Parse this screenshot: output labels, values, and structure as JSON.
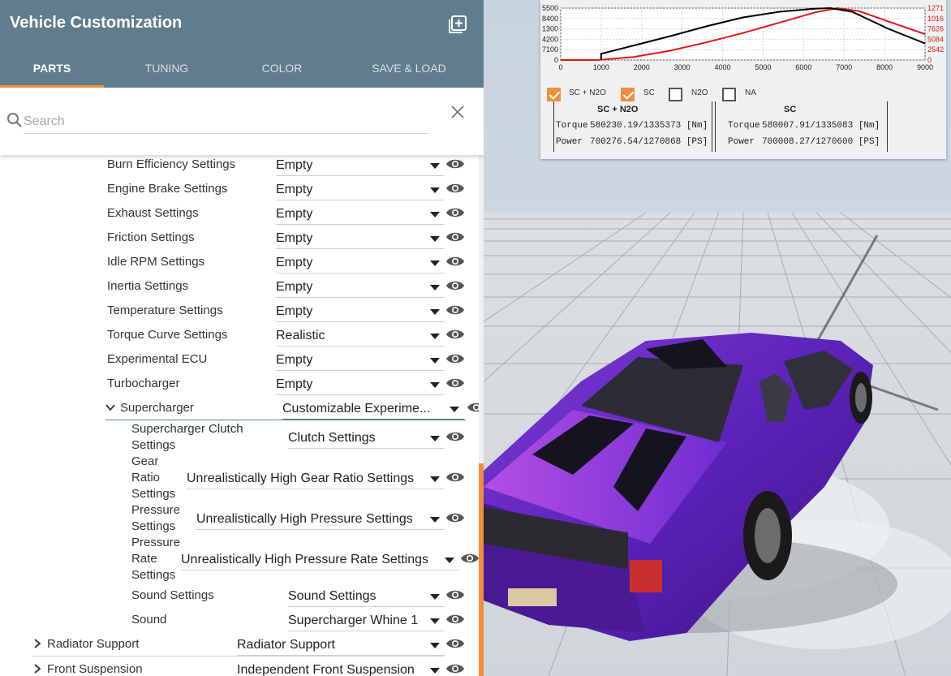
{
  "header": {
    "title": "Vehicle Customization",
    "tabs": [
      {
        "label": "PARTS",
        "active": true
      },
      {
        "label": "TUNING",
        "active": false
      },
      {
        "label": "COLOR",
        "active": false
      },
      {
        "label": "SAVE & LOAD",
        "active": false
      }
    ]
  },
  "search": {
    "placeholder": "Search",
    "value": ""
  },
  "parts": [
    {
      "label": "Burn Efficiency Settings",
      "value": "Empty"
    },
    {
      "label": "Engine Brake Settings",
      "value": "Empty"
    },
    {
      "label": "Exhaust Settings",
      "value": "Empty"
    },
    {
      "label": "Friction Settings",
      "value": "Empty"
    },
    {
      "label": "Idle RPM Settings",
      "value": "Empty"
    },
    {
      "label": "Inertia Settings",
      "value": "Empty"
    },
    {
      "label": "Temperature Settings",
      "value": "Empty"
    },
    {
      "label": "Torque Curve Settings",
      "value": "Realistic"
    },
    {
      "label": "Experimental ECU",
      "value": "Empty"
    },
    {
      "label": "Turbocharger",
      "value": "Empty"
    }
  ],
  "supercharger": {
    "label": "Supercharger",
    "value": "Customizable Experime...",
    "children": [
      {
        "label_lines": [
          "Supercharger Clutch",
          "Settings"
        ],
        "value": "Clutch Settings"
      },
      {
        "label_lines": [
          "Gear",
          "Ratio",
          "Settings"
        ],
        "value": "Unrealistically High Gear Ratio Settings"
      },
      {
        "label_lines": [
          "Pressure",
          "Settings"
        ],
        "value": "Unrealistically High Pressure Settings"
      },
      {
        "label_lines": [
          "Pressure",
          "Rate",
          "Settings"
        ],
        "value": "Unrealistically High Pressure Rate Settings"
      },
      {
        "label_lines": [
          "Sound Settings"
        ],
        "value": "Sound Settings"
      },
      {
        "label_lines": [
          "Sound"
        ],
        "value": "Supercharger Whine 1"
      }
    ]
  },
  "collapsed": [
    {
      "label": "Radiator Support",
      "value": "Radiator Support"
    },
    {
      "label": "Front Suspension",
      "value": "Independent Front Suspension"
    }
  ],
  "graph": {
    "left_ticks": [
      "5500",
      "8400",
      "1300",
      "4200",
      "7100",
      "0"
    ],
    "right_ticks": [
      "1271",
      "1016",
      "7626",
      "5084",
      "2542",
      "0"
    ],
    "x_ticks": [
      "0",
      "1000",
      "2000",
      "3000",
      "4000",
      "5000",
      "6000",
      "7000",
      "8000",
      "9000"
    ],
    "toggles": [
      {
        "label": "SC + N2O",
        "checked": true
      },
      {
        "label": "SC",
        "checked": true
      },
      {
        "label": "N2O",
        "checked": false
      },
      {
        "label": "NA",
        "checked": false
      }
    ],
    "stats": [
      {
        "title": "SC + N2O",
        "torque_label": "Torque",
        "torque": "580230.19/1335373 [Nm]",
        "power_label": "Power",
        "power": "700276.54/1270868 [PS]"
      },
      {
        "title": "SC",
        "torque_label": "Torque",
        "torque": "580007.91/1335083 [Nm]",
        "power_label": "Power",
        "power": "700008.27/1270600 [PS]"
      }
    ],
    "colors": {
      "torque": "#000000",
      "power": "#e01818",
      "right_axis": "#e01818"
    }
  },
  "colors": {
    "header": "#5f7d8c",
    "accent": "#ef8f3b",
    "car": "#6a2fd6"
  }
}
